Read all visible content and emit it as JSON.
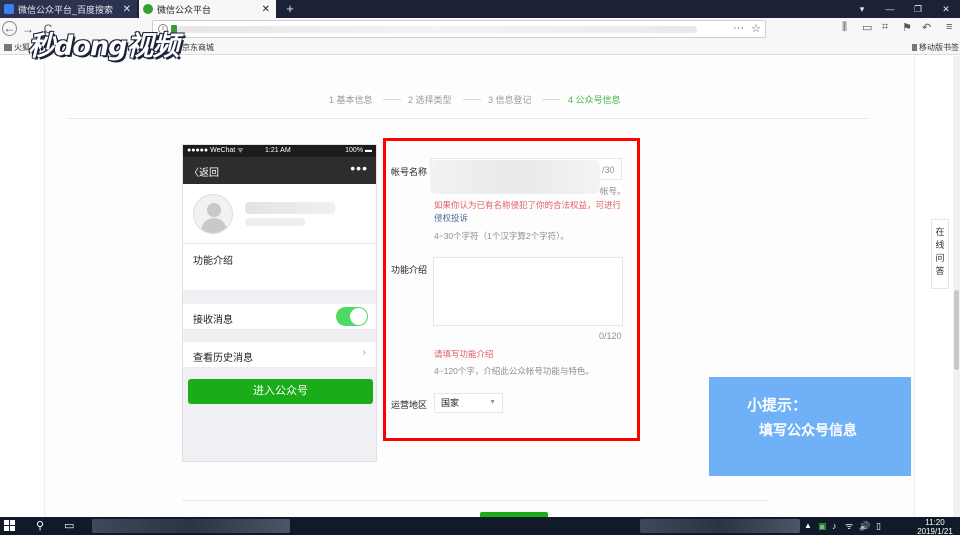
{
  "browser": {
    "tabs": [
      {
        "label": "微信公众平台_百度搜索",
        "close": "✕",
        "favicon_color": "#3d7ff2"
      },
      {
        "label": "微信公众平台",
        "close": "✕",
        "favicon_color": "#31a335"
      }
    ],
    "new_tab": "+",
    "window_controls": [
      "▾",
      "—",
      "❐",
      "✕"
    ],
    "nav": {
      "back": "←",
      "forward": "→",
      "reload": "C"
    },
    "url_more": "···",
    "url_star": "☆",
    "right_icons": [
      "⫼",
      "▭",
      "⌗",
      "⚑",
      "↶",
      "≡"
    ],
    "bookmarks": [
      {
        "label": "火狐"
      },
      {
        "label": "京东商城"
      },
      {
        "label": "移动版书签"
      }
    ]
  },
  "watermark": "秒dong视频",
  "steps": [
    {
      "label": "1 基本信息",
      "current": false
    },
    {
      "label": "2 选择类型",
      "current": false
    },
    {
      "label": "3 信息登记",
      "current": false
    },
    {
      "label": "4 公众号信息",
      "current": true
    }
  ],
  "phone": {
    "status_left": "●●●●● WeChat ᯤ",
    "status_time": "1:21 AM",
    "status_battery": "100% ▬",
    "back_label": "〈返回",
    "more": "•••",
    "intro_label": "功能介绍",
    "receive_label": "接收消息",
    "receive_on": true,
    "history_label": "查看历史消息",
    "chevron": "›",
    "enter_button": "进入公众号"
  },
  "form": {
    "account_name_label": "帐号名称",
    "account_counter": "/30",
    "account_hint_tail": "帐号。",
    "infringe_text": "如果你认为已有名称侵犯了你的合法权益，可进行",
    "infringe_link": "侵权投诉",
    "account_rule": "4~30个字符（1个汉字算2个字符）。",
    "intro_label": "功能介绍",
    "intro_counter": "0/120",
    "intro_error": "请填写功能介绍",
    "intro_rule": "4~120个字，介绍此公众帐号功能与特色。",
    "region_label": "运营地区",
    "region_value": "国家",
    "region_caret": "▼"
  },
  "side_float": [
    "在",
    "线",
    "问",
    "答"
  ],
  "tip_overlay": {
    "title": "小提示：",
    "body": "填写公众号信息"
  },
  "taskbar": {
    "search_icon": "⚲",
    "taskview_icon": "▭",
    "time": "11:20",
    "date": "2019/1/21",
    "tray": [
      "▲",
      "▣",
      "♪",
      "ᯤ",
      "🔊",
      "▯"
    ]
  }
}
